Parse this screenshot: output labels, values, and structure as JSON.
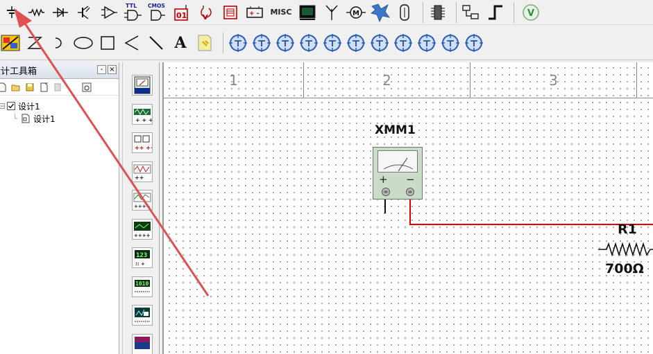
{
  "toolbar_components": {
    "icons": [
      "dc-power-source-icon",
      "resistor-basic-icon",
      "diode-icon",
      "transistor-icon",
      "analog-opamp-icon",
      "ttl-gate-icon",
      "cmos-gate-icon",
      "mixed-digital-icon",
      "indicator-icon",
      "power-component-icon",
      "misc-digital-icon",
      "misc-label",
      "advanced-peripheral-icon",
      "rf-antenna-icon",
      "electromechanical-icon",
      "mcu-icon",
      "connector-icon",
      "hierarchy-icon",
      "bus-icon"
    ],
    "ttl_label": "TTL",
    "cmos_label": "CMOS",
    "misc_label": "MISC"
  },
  "toolbar_drawing": {
    "icons": [
      "place-component-icon",
      "graph-icon",
      "arc-icon",
      "ellipse-icon",
      "rectangle-icon",
      "polyline-icon",
      "line-icon",
      "text-icon",
      "comment-icon"
    ],
    "text_tool_label": "A"
  },
  "toolbar_instruments_row": {
    "count": 11
  },
  "toolbox": {
    "title": "设计工具箱",
    "min_glyph": "-",
    "close_glyph": "×",
    "tree": {
      "root": "设计1",
      "child": "设计1"
    }
  },
  "canvas": {
    "ruler": [
      "1",
      "2",
      "3"
    ],
    "multimeter_label": "XMM1",
    "multimeter_plus": "+",
    "multimeter_minus": "−",
    "resistor_label": "R1",
    "resistor_value": "700Ω"
  },
  "colors": {
    "wire": "#e00000",
    "annotation_arrow": "#e05050",
    "instrument_body": "#c8dcc8"
  }
}
